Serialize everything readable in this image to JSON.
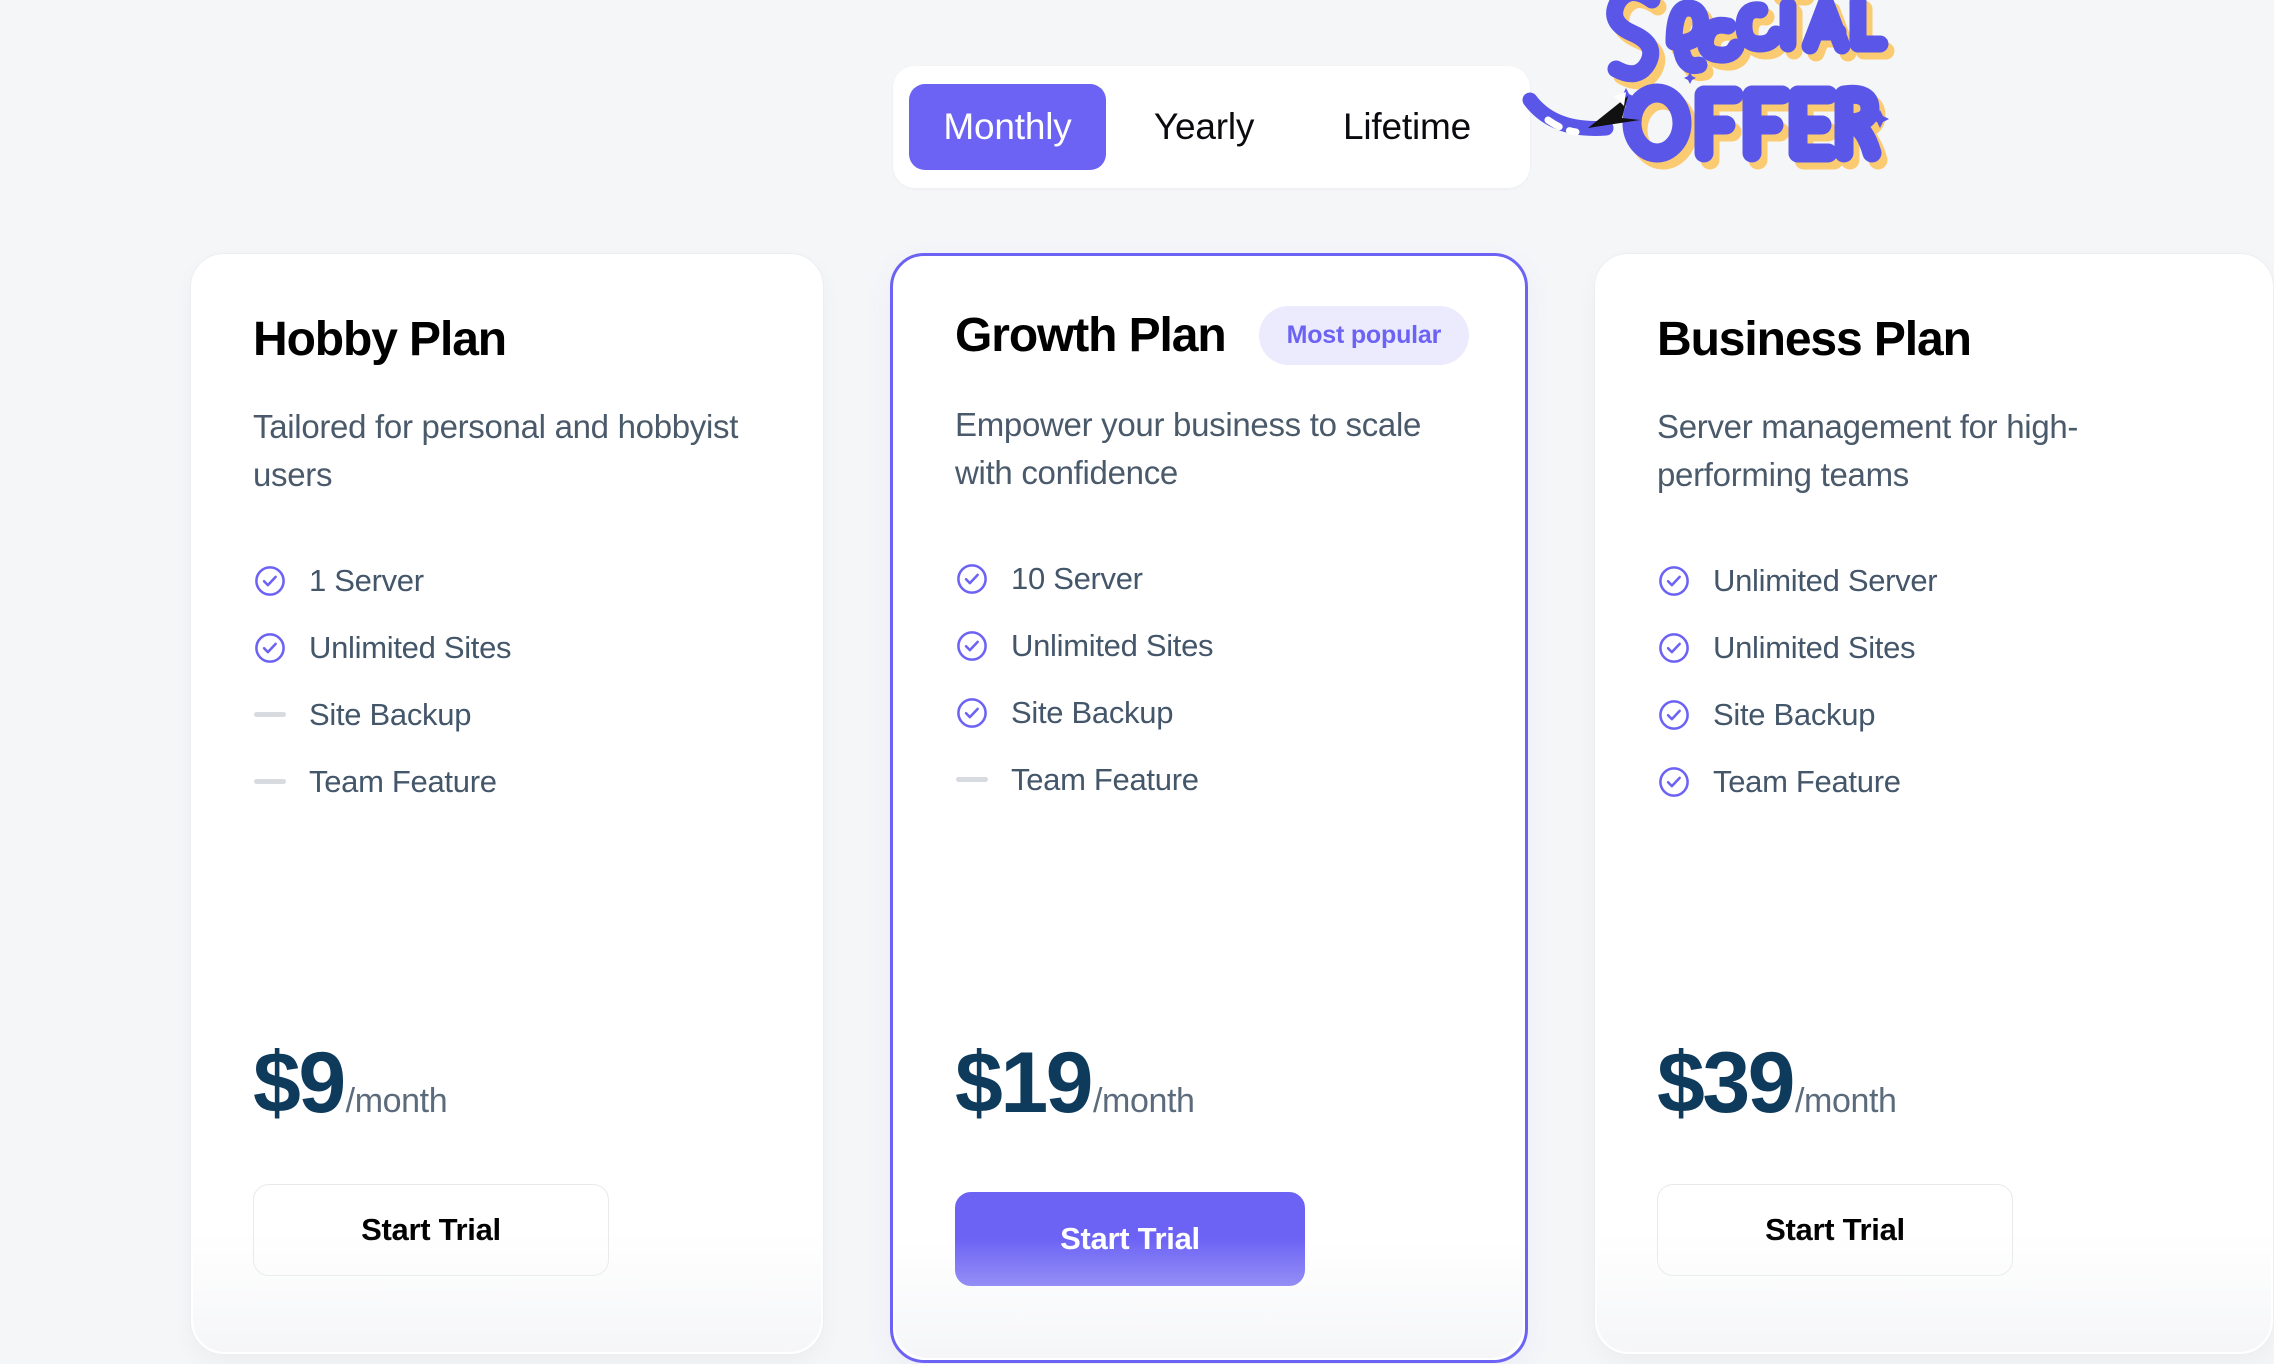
{
  "billing_toggle": {
    "options": [
      {
        "label": "Monthly",
        "active": true
      },
      {
        "label": "Yearly",
        "active": false
      },
      {
        "label": "Lifetime",
        "active": false
      }
    ]
  },
  "promo": {
    "art_name": "special-offer-lettering",
    "line1": "SPECIAL",
    "line2": "OFFER",
    "arrow": "curved-arrow-pointing-to-toggle"
  },
  "colors": {
    "accent": "#6c63f5",
    "accent_soft": "#eceafd",
    "price": "#0e3a5c",
    "muted_text": "#4a5a6a",
    "page_bg": "#f5f6f8",
    "card_bg": "#ffffff",
    "dash": "#d7dbe0",
    "offer_shadow": "#fcc96b"
  },
  "plans": [
    {
      "id": "hobby",
      "title": "Hobby Plan",
      "badge": null,
      "description": "Tailored for personal and hobbyist users",
      "features": [
        {
          "label": "1 Server",
          "included": true
        },
        {
          "label": "Unlimited Sites",
          "included": true
        },
        {
          "label": "Site Backup",
          "included": false
        },
        {
          "label": "Team Feature",
          "included": false
        }
      ],
      "price": "$9",
      "period": "/month",
      "cta_label": "Start Trial",
      "featured": false
    },
    {
      "id": "growth",
      "title": "Growth Plan",
      "badge": "Most popular",
      "description": "Empower your business to scale with confidence",
      "features": [
        {
          "label": "10 Server",
          "included": true
        },
        {
          "label": "Unlimited Sites",
          "included": true
        },
        {
          "label": "Site Backup",
          "included": true
        },
        {
          "label": "Team Feature",
          "included": false
        }
      ],
      "price": "$19",
      "period": "/month",
      "cta_label": "Start Trial",
      "featured": true
    },
    {
      "id": "business",
      "title": "Business Plan",
      "badge": null,
      "description": "Server management for high-performing teams",
      "features": [
        {
          "label": "Unlimited Server",
          "included": true
        },
        {
          "label": "Unlimited Sites",
          "included": true
        },
        {
          "label": "Site Backup",
          "included": true
        },
        {
          "label": "Team Feature",
          "included": true
        }
      ],
      "price": "$39",
      "period": "/month",
      "cta_label": "Start Trial",
      "featured": false
    }
  ]
}
